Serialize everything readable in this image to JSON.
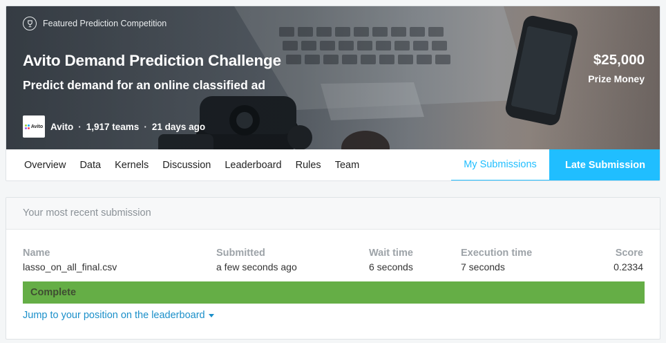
{
  "banner": {
    "featured_label": "Featured Prediction Competition",
    "title": "Avito Demand Prediction Challenge",
    "subtitle": "Predict demand for an online classified ad",
    "prize_amount": "$25,000",
    "prize_label": "Prize Money",
    "host": {
      "logo_text": "Avito",
      "name": "Avito",
      "separator": "·",
      "teams": "1,917 teams",
      "age": "21 days ago"
    }
  },
  "nav": {
    "tabs": [
      "Overview",
      "Data",
      "Kernels",
      "Discussion",
      "Leaderboard",
      "Rules",
      "Team"
    ],
    "my_submissions": "My Submissions",
    "late_submission": "Late Submission"
  },
  "submission": {
    "header": "Your most recent submission",
    "columns": {
      "name": {
        "label": "Name",
        "value": "lasso_on_all_final.csv"
      },
      "submitted": {
        "label": "Submitted",
        "value": "a few seconds ago"
      },
      "wait_time": {
        "label": "Wait time",
        "value": "6 seconds"
      },
      "execution_time": {
        "label": "Execution time",
        "value": "7 seconds"
      },
      "score": {
        "label": "Score",
        "value": "0.2334"
      }
    },
    "status": "Complete",
    "jump_link": "Jump to your position on the leaderboard"
  },
  "colors": {
    "accent": "#20beff",
    "status_complete": "#65ae46",
    "link": "#1a8fc9"
  },
  "icons": {
    "featured": "trophy-icon",
    "jump": "caret-down-icon"
  }
}
